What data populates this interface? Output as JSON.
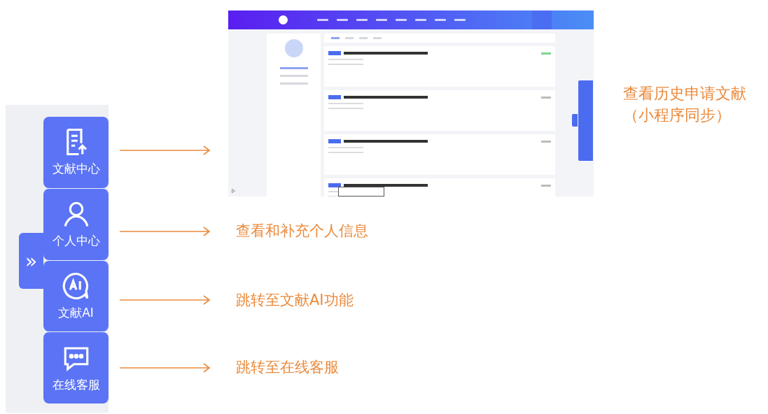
{
  "callout_top": [
    "查看历史申请文献",
    "（小程序同步）"
  ],
  "side_panel": {
    "toggle": "»",
    "items": [
      {
        "label": "文献中心"
      },
      {
        "label": "个人中心"
      },
      {
        "label": "文献AI"
      },
      {
        "label": "在线客服"
      }
    ]
  },
  "callouts": [
    "查看和补充个人信息",
    "跳转至文献AI功能",
    "跳转至在线客服"
  ]
}
